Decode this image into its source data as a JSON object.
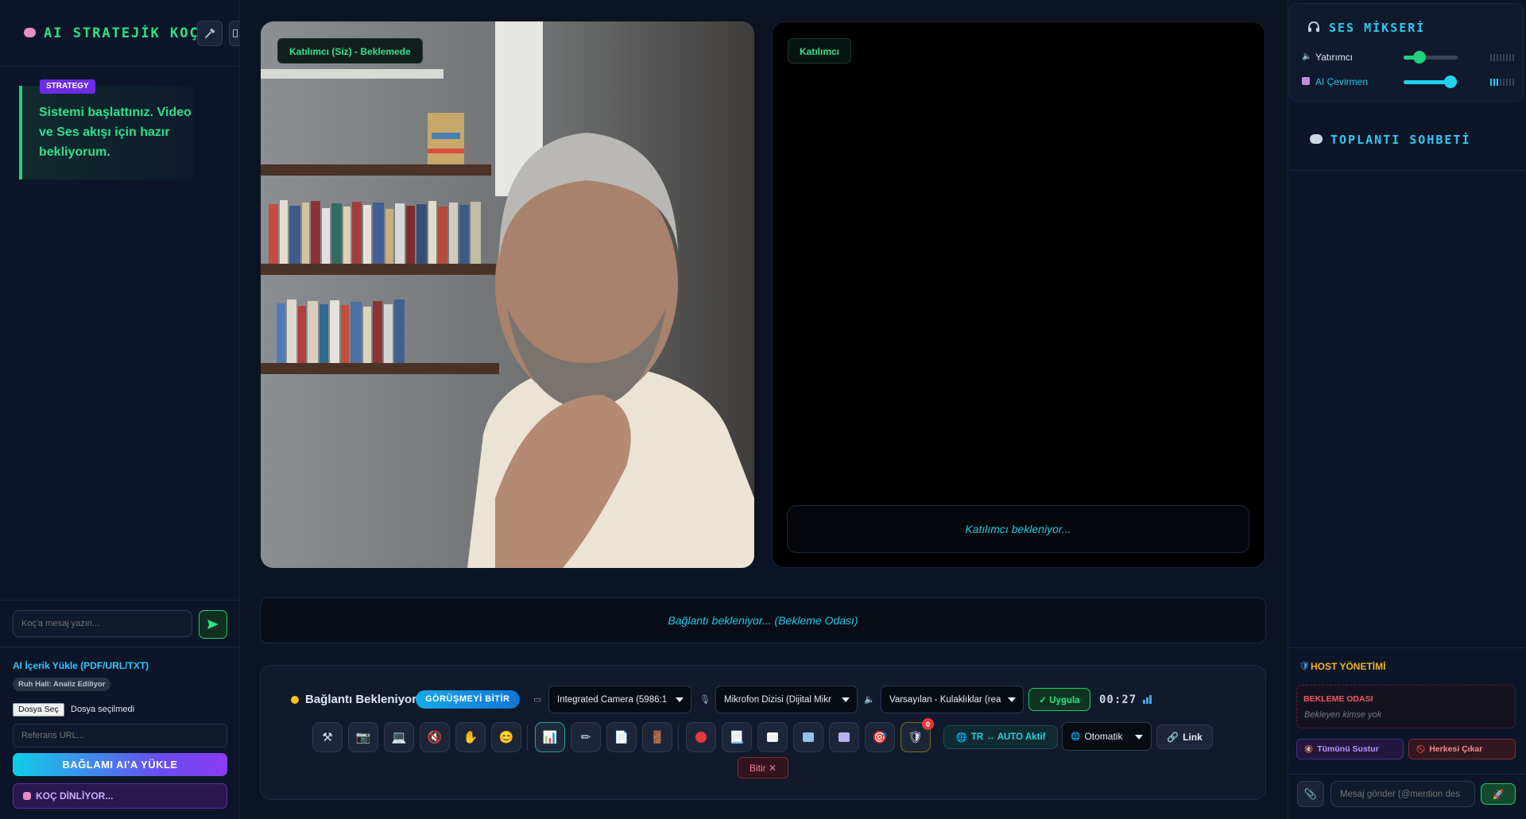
{
  "coach": {
    "title": "AI STRATEJİK KOÇ",
    "strategy_badge": "STRATEGY",
    "strategy_message": "Sistemi başlattınız. Video ve Ses akışı için hazır bekliyorum.",
    "input_placeholder": "Koç'a mesaj yazın...",
    "upload_title": "AI İçerik Yükle (PDF/URL/TXT)",
    "mood_badge": "Ruh Hali: Analiz Ediliyor",
    "file_button": "Dosya Seç",
    "file_status": "Dosya seçilmedi",
    "url_placeholder": "Referans URL...",
    "load_button": "BAĞLAMI AI'A YÜKLE",
    "listening_button": "KOÇ DİNLİYOR..."
  },
  "video": {
    "self_label": "Katılımcı (Siz) - Beklemede",
    "remote_label": "Katılımcı",
    "remote_waiting": "Katılımcı bekleniyor..."
  },
  "status_bar": {
    "text": "Bağlantı bekleniyor... (Bekleme Odası)"
  },
  "controls": {
    "connection_status": "Bağlantı Bekleniyor",
    "end_meeting": "GÖRÜŞMEYİ BİTİR",
    "camera_select": "Integrated Camera (5986:1",
    "mic_select": "Mikrofon Dizisi (Dijital Mikr",
    "speaker_select": "Varsayılan - Kulaklıklar (rea",
    "apply_button": "✓ Uygula",
    "timer": "00:27",
    "badge_count": "0",
    "translate_button": "TR ↔ AUTO Aktif",
    "language_select": "Otomatik",
    "link_button": "Link",
    "finish_button": "Bitir ✕"
  },
  "mixer": {
    "title": "SES MİKSERİ",
    "channels": [
      {
        "label": "Yatırımcı",
        "level": 0.3,
        "color": "#1fd47a"
      },
      {
        "label": "AI Çevirmen",
        "level": 0.87,
        "color": "#22d3ee"
      }
    ]
  },
  "chat": {
    "title": "TOPLANTI SOHBETİ",
    "input_placeholder": "Mesaj gönder (@mention des"
  },
  "host": {
    "title": "HOST YÖNETİMİ",
    "waiting_room_title": "BEKLEME ODASI",
    "waiting_room_empty": "Bekleyen kimse yok",
    "mute_all": "Tümünü Sustur",
    "kick_all": "Herkesi Çıkar"
  }
}
